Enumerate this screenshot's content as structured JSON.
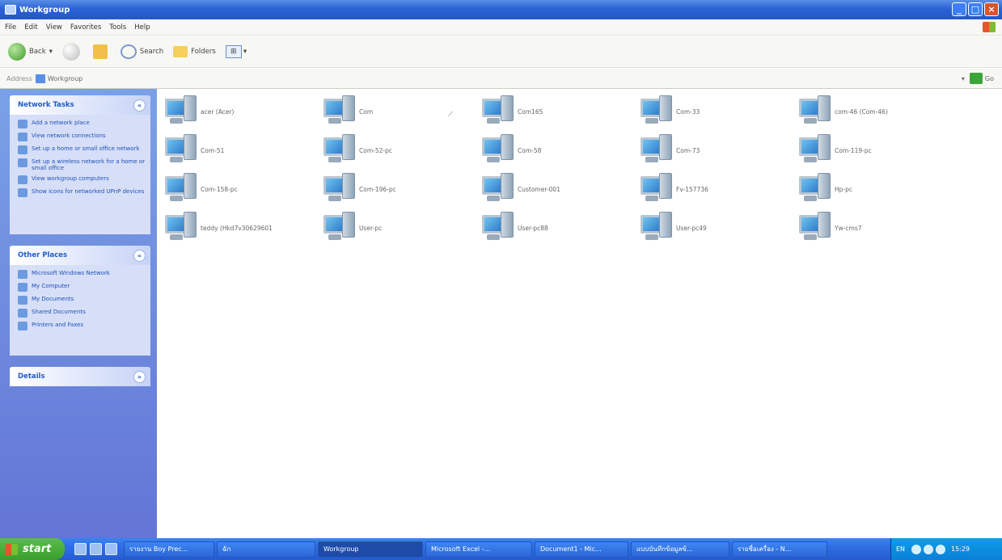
{
  "window": {
    "title": "Workgroup"
  },
  "menu": [
    "File",
    "Edit",
    "View",
    "Favorites",
    "Tools",
    "Help"
  ],
  "toolbar": {
    "back": "Back",
    "search": "Search",
    "folders": "Folders"
  },
  "address": {
    "label": "Address",
    "value": "Workgroup",
    "go": "Go"
  },
  "sidebar": {
    "network_tasks": {
      "title": "Network Tasks",
      "items": [
        "Add a network place",
        "View network connections",
        "Set up a home or small office network",
        "Set up a wireless network for a home or small office",
        "View workgroup computers",
        "Show icons for networked UPnP devices"
      ]
    },
    "other_places": {
      "title": "Other Places",
      "items": [
        "Microsoft Windows Network",
        "My Computer",
        "My Documents",
        "Shared Documents",
        "Printers and Faxes"
      ]
    },
    "details": {
      "title": "Details"
    }
  },
  "computers": [
    "acer (Acer)",
    "Com",
    "Com165",
    "Com-33",
    "com-46 (Com-46)",
    "Com-51",
    "Com-52-pc",
    "Com-58",
    "Com-73",
    "Com-119-pc",
    "Com-158-pc",
    "Com-196-pc",
    "Customer-001",
    "Fv-157736",
    "Hp-pc",
    "teddy (Hkd7v30629601",
    "User-pc",
    "User-pc88",
    "User-pc49",
    "Yw-cms7"
  ],
  "taskbar": {
    "start": "start",
    "buttons": [
      "รายงาน Boy Prec...",
      "ฉัก",
      "Workgroup",
      "Microsoft Excel -...",
      "Document1 - Mic...",
      "แบบบันทึกข้อมูลข้...",
      "รายชื่อเครื่อง - N..."
    ],
    "lang": "EN",
    "time": "15:29"
  }
}
